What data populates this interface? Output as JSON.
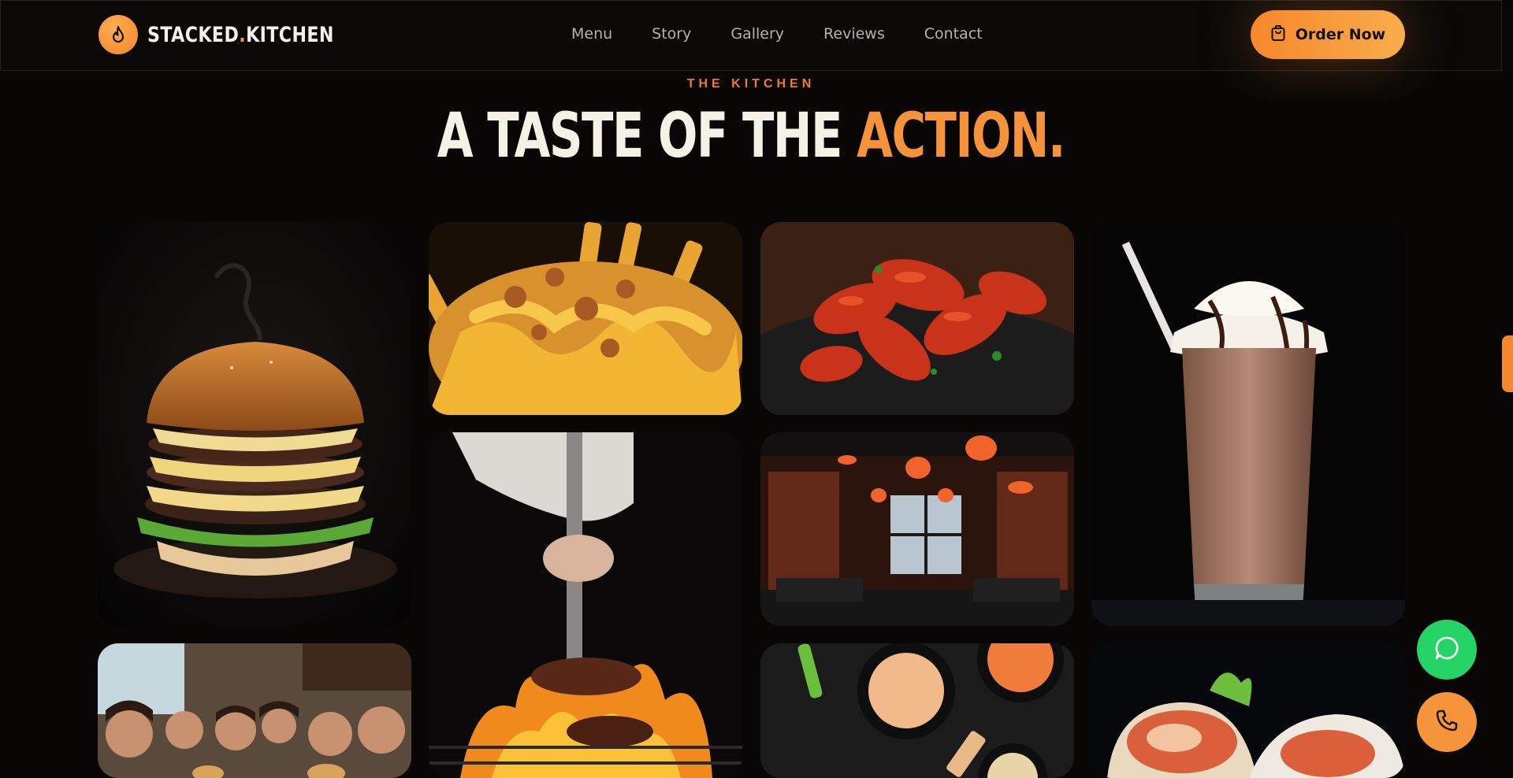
{
  "brand": {
    "name_part1": "STACKED",
    "dot": ".",
    "name_part2": "KITCHEN",
    "icon": "flame-icon"
  },
  "nav": {
    "items": [
      {
        "label": "Menu"
      },
      {
        "label": "Story"
      },
      {
        "label": "Gallery"
      },
      {
        "label": "Reviews"
      },
      {
        "label": "Contact"
      }
    ]
  },
  "header": {
    "cta_label": "Order Now",
    "cta_icon": "shopping-bag-icon"
  },
  "section": {
    "eyebrow": "THE KITCHEN",
    "title_main": "A TASTE OF THE ",
    "title_accent": "ACTION."
  },
  "gallery": {
    "tiles": [
      {
        "subject": "stacked-burger-photo"
      },
      {
        "subject": "loaded-fries-photo"
      },
      {
        "subject": "buffalo-wings-photo"
      },
      {
        "subject": "chocolate-milkshake-photo"
      },
      {
        "subject": "flame-grill-photo"
      },
      {
        "subject": "restaurant-interior-photo"
      },
      {
        "subject": "happy-diners-photo"
      },
      {
        "subject": "dipping-sauces-photo"
      },
      {
        "subject": "chicken-wrap-photo"
      }
    ]
  },
  "floating": {
    "chat_icon": "chat-bubble-icon",
    "call_icon": "phone-icon"
  },
  "colors": {
    "background": "#080706",
    "accent": "#f5923a",
    "accent_deep": "#f07a2b",
    "chat_green": "#25d366"
  }
}
